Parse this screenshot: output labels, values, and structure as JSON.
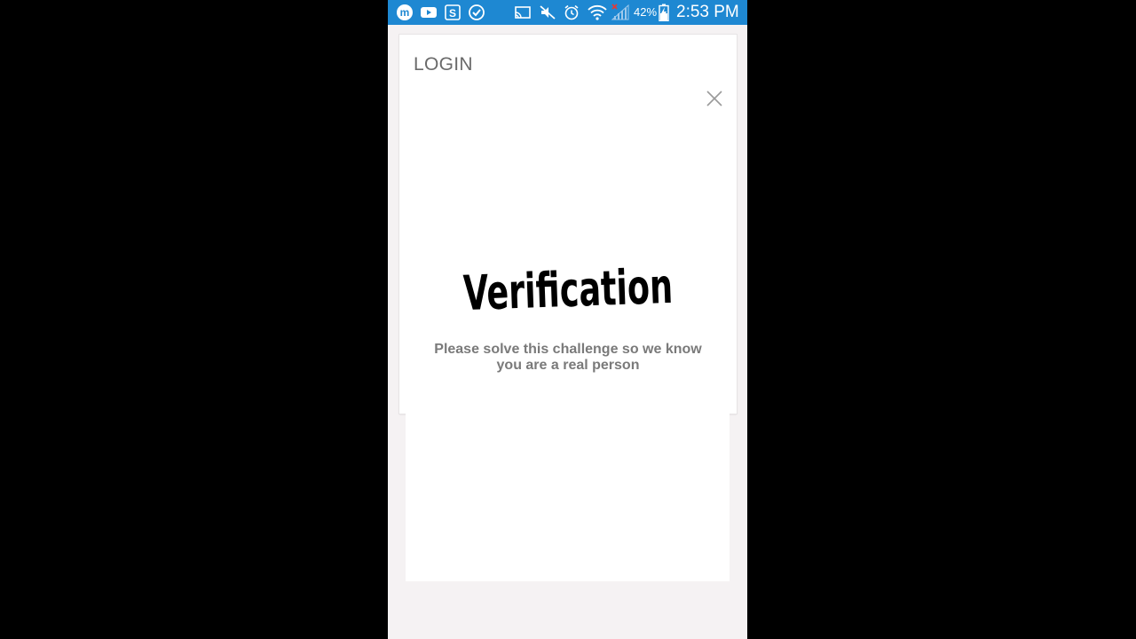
{
  "status_bar": {
    "icons": [
      "messenger-icon",
      "youtube-icon",
      "skype-icon",
      "check-circle-icon",
      "cast-icon",
      "mute-icon",
      "alarm-icon",
      "wifi-icon",
      "signal-icon",
      "battery-icon"
    ],
    "battery_percent": "42%",
    "time": "2:53 PM",
    "bar_color": "#1e88d2"
  },
  "dialog": {
    "title": "LOGIN",
    "close_icon": "close-icon",
    "verification_heading": "Verification",
    "verification_message_line1": "Please solve this challenge so we know",
    "verification_message_line2": "you are a real person"
  }
}
